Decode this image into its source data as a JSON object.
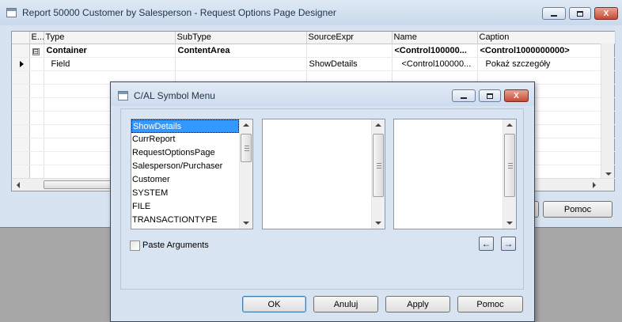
{
  "outer_window": {
    "title": "Report 50000 Customer by Salesperson - Request Options Page Designer",
    "minimize_glyph": "_",
    "maximize_glyph": "□",
    "close_glyph": "X",
    "help_button": "Pomoc"
  },
  "grid": {
    "columns": [
      "E...",
      "Type",
      "SubType",
      "SourceExpr",
      "Name",
      "Caption"
    ],
    "rows": [
      {
        "indent": "⊟",
        "type": "Container",
        "subtype": "ContentArea",
        "sourceexpr": "",
        "name": "<Control100000...",
        "caption": "<Control1000000000>"
      },
      {
        "indent": "",
        "type": "Field",
        "subtype": "",
        "sourceexpr": "ShowDetails",
        "name": "<Control100000...",
        "caption": "Pokaż szczegóły"
      }
    ]
  },
  "dialog": {
    "title": "C/AL Symbol Menu",
    "list1": [
      "ShowDetails",
      "CurrReport",
      "RequestOptionsPage",
      "Salesperson/Purchaser",
      "Customer",
      "SYSTEM",
      "FILE",
      "TRANSACTIONTYPE"
    ],
    "paste_arguments_label": "Paste Arguments",
    "nav_prev": "←",
    "nav_next": "→",
    "buttons": {
      "ok": "OK",
      "cancel": "Anuluj",
      "apply": "Apply",
      "help": "Pomoc"
    }
  },
  "icons": {
    "app": "window-icon",
    "row_pointer": "row-pointer-icon",
    "collapse": "collapse-icon"
  }
}
